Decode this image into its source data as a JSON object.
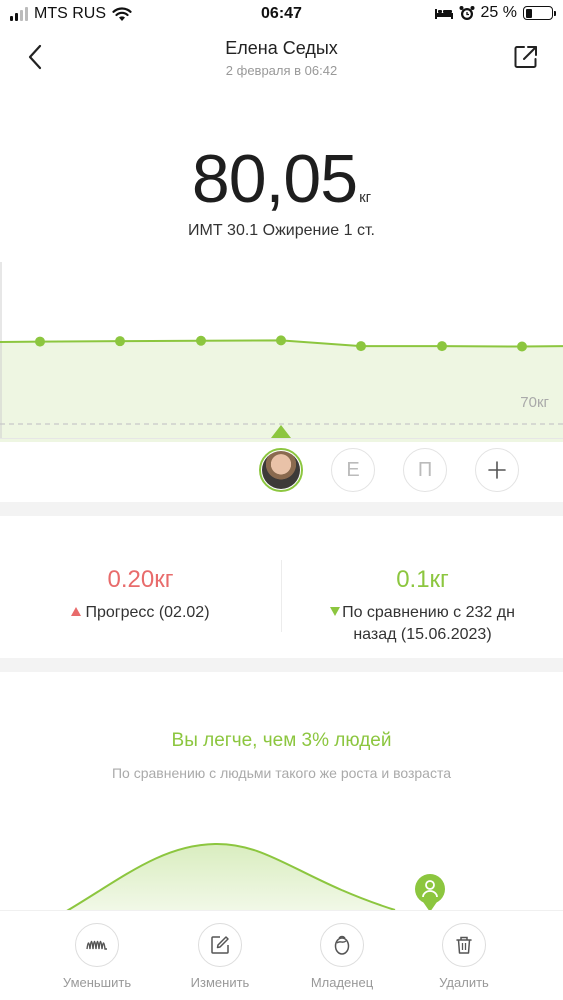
{
  "status_bar": {
    "carrier": "MTS RUS",
    "time": "06:47",
    "battery": "25 %",
    "battery_level": 0.25,
    "icons": [
      "signal-icon",
      "wifi-icon",
      "bed-icon",
      "alarm-icon",
      "battery-icon"
    ]
  },
  "header": {
    "title": "Елена Седых",
    "subtitle": "2 февраля в 06:42",
    "icons": [
      "back-chevron-icon",
      "share-icon"
    ]
  },
  "measurement": {
    "weight": "80,05",
    "unit": "кг",
    "bmi_text": "ИМТ 30.1 Ожирение 1 ст."
  },
  "chart_data": {
    "type": "area",
    "y_values": [
      80.05,
      80.1,
      80.15,
      80.2,
      79.5,
      79.5,
      79.45
    ],
    "reference_line": {
      "value": 70,
      "label": "70кг"
    },
    "selected_index": 3,
    "colors": {
      "line": "#8cc63f",
      "fill": "#eef6e2",
      "ref_line": "#c8c8c8"
    }
  },
  "profiles": [
    {
      "type": "avatar",
      "label": "",
      "active": true
    },
    {
      "type": "letter",
      "label": "Е",
      "active": false
    },
    {
      "type": "letter",
      "label": "П",
      "active": false
    },
    {
      "type": "add",
      "label": "+",
      "active": false
    }
  ],
  "progress": {
    "left": {
      "value": "0.20кг",
      "text": "Прогресс (02.02)",
      "color": "#e86b6b"
    },
    "right": {
      "value": "0.1кг",
      "text_line1": "По сравнению с 232 дн",
      "text_line2": "назад (15.06.2023)",
      "color": "#8cc63f"
    }
  },
  "comparison": {
    "title": "Вы легче, чем 3% людей",
    "subtitle": "По сравнению с людьми такого же роста и возраста",
    "percentile": 3,
    "marker_icon": "person-pin-icon"
  },
  "toolbar": {
    "items": [
      {
        "label": "Уменьшить",
        "icon": "wave-icon"
      },
      {
        "label": "Изменить",
        "icon": "edit-icon"
      },
      {
        "label": "Младенец",
        "icon": "baby-icon"
      },
      {
        "label": "Удалить",
        "icon": "trash-icon"
      }
    ]
  }
}
